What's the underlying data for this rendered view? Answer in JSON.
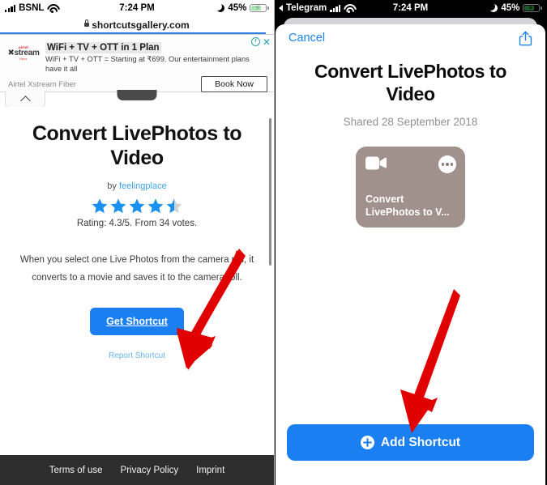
{
  "left": {
    "status_bar": {
      "carrier": "BSNL",
      "time": "7:24 PM",
      "battery_percent": "45%",
      "signal_icon": "signal-bars-icon",
      "wifi_icon": "wifi-icon",
      "dnd_icon": "moon-icon",
      "battery_icon": "battery-charging-icon"
    },
    "browser": {
      "url": "shortcutsgallery.com",
      "lock_icon": "lock-icon",
      "collapse_icon": "chevron-up-icon"
    },
    "ad": {
      "headline": "WiFi + TV + OTT in 1 Plan",
      "description": "WiFi + TV + OTT = Starting at ₹699. Our entertainment plans have it all",
      "advertiser": "Airtel Xstream Fiber",
      "cta_label": "Book Now",
      "logo_top": "airtel",
      "logo_main": "stream",
      "logo_bottom": "fiber",
      "info_icon": "ad-info-icon",
      "close_icon": "ad-close-icon"
    },
    "page": {
      "title": "Convert LivePhotos to Video",
      "by_prefix": "by",
      "author": "feelingplace",
      "rating_text": "Rating: 4.3/5. From 34 votes.",
      "rating_value": 4.3,
      "stars_filled": 4,
      "stars_half": 1,
      "stars_total": 5,
      "description": "When you select one Live Photos from the camera roll, it converts to a movie and saves it to the camera roll.",
      "get_button": "Get Shortcut",
      "report_link": "Report Shortcut"
    },
    "footer": {
      "links": [
        "Terms of use",
        "Privacy Policy",
        "Imprint"
      ]
    }
  },
  "right": {
    "status_bar": {
      "back_label": "Telegram",
      "back_icon": "back-triangle-icon",
      "time": "7:24 PM",
      "battery_percent": "45%",
      "signal_icon": "signal-bars-icon",
      "wifi_icon": "wifi-icon",
      "dnd_icon": "moon-icon",
      "battery_icon": "battery-charging-icon"
    },
    "sheet": {
      "cancel_label": "Cancel",
      "share_icon": "share-icon",
      "title": "Convert LivePhotos to Video",
      "shared_date": "Shared 28 September 2018",
      "card": {
        "label": "Convert LivePhotos to V...",
        "icon": "video-camera-icon",
        "more_icon": "ellipsis-icon",
        "color": "#a1918c"
      },
      "add_button": "Add Shortcut",
      "add_icon": "plus-circle-icon"
    }
  },
  "annotations": {
    "arrow_color": "#e00000",
    "left_arrow": "red-arrow-pointing-to-get-shortcut",
    "right_arrow": "red-arrow-pointing-to-add-shortcut"
  },
  "colors": {
    "ios_blue": "#1a7ff0",
    "link_blue": "#3da3e8",
    "star_blue": "#1a90f0",
    "battery_green": "#35c759",
    "footer_bg": "#2d2d2d",
    "card_taupe": "#a1918c"
  }
}
